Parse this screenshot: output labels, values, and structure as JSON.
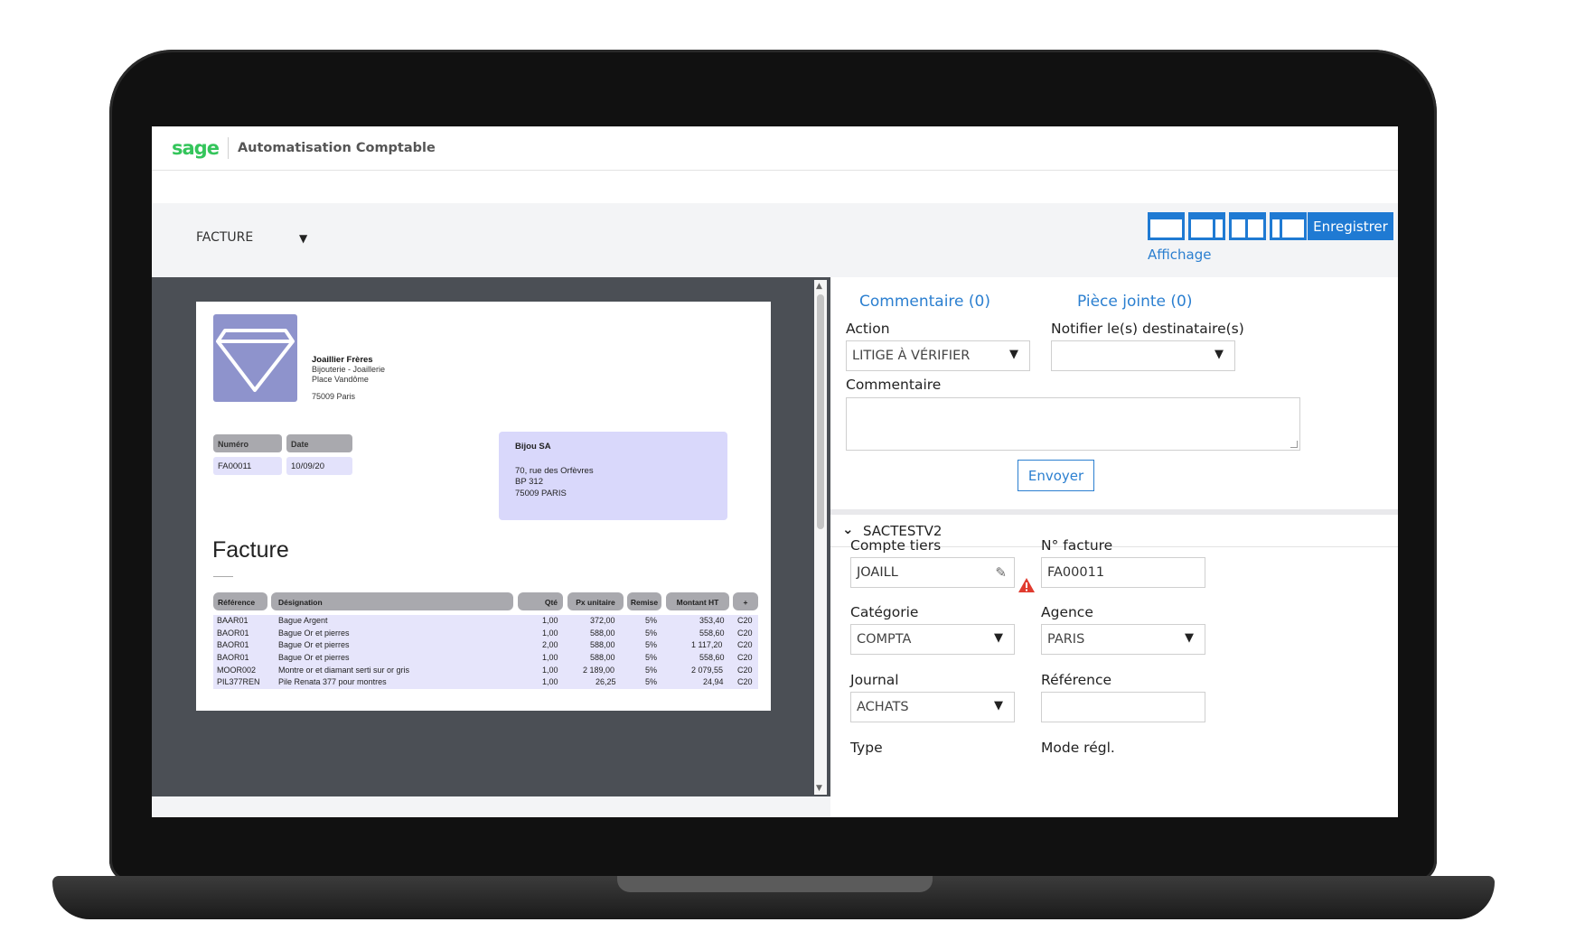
{
  "header": {
    "logo": "sage",
    "app_title": "Automatisation Comptable"
  },
  "toolbar": {
    "doc_type": "FACTURE",
    "save_label": "Enregistrer",
    "affichage_label": "Affichage"
  },
  "invoice": {
    "company_name": "Joaillier Frères",
    "company_line1": "Bijouterie - Joaillerie",
    "company_line2": "Place Vandôme",
    "company_city": "75009 Paris",
    "numero_label": "Numéro",
    "date_label": "Date",
    "numero": "FA00011",
    "date": "10/09/20",
    "client_name": "Bijou SA",
    "client_addr1": "70, rue des Orfèvres",
    "client_addr2": "BP 312",
    "client_addr3": "75009 PARIS",
    "title": "Facture",
    "columns": [
      "Référence",
      "Désignation",
      "Qté",
      "Px unitaire",
      "Remise",
      "Montant HT",
      "+"
    ],
    "rows": [
      [
        "BAAR01",
        "Bague Argent",
        "1,00",
        "372,00",
        "5%",
        "353,40",
        "C20"
      ],
      [
        "BAOR01",
        "Bague Or et pierres",
        "1,00",
        "588,00",
        "5%",
        "558,60",
        "C20"
      ],
      [
        "BAOR01",
        "Bague Or et pierres",
        "2,00",
        "588,00",
        "5%",
        "1 117,20",
        "C20"
      ],
      [
        "BAOR01",
        "Bague Or et pierres",
        "1,00",
        "588,00",
        "5%",
        "558,60",
        "C20"
      ],
      [
        "MOOR002",
        "Montre or et diamant serti sur or gris",
        "1,00",
        "2 189,00",
        "5%",
        "2 079,55",
        "C20"
      ],
      [
        "PIL377REN",
        "Pile Renata 377 pour montres",
        "1,00",
        "26,25",
        "5%",
        "24,94",
        "C20"
      ]
    ]
  },
  "panel": {
    "comment_tab": "Commentaire (0)",
    "attachment_tab": "Pièce jointe (0)",
    "action_label": "Action",
    "action_value": "LITIGE À VÉRIFIER",
    "notify_label": "Notifier le(s) destinataire(s)",
    "notify_value": "",
    "comment_label": "Commentaire",
    "send_label": "Envoyer",
    "section_title": "SACTESTV2",
    "compte_label": "Compte tiers",
    "compte_value": "JOAILL",
    "facture_label": "N° facture",
    "facture_value": "FA00011",
    "categorie_label": "Catégorie",
    "categorie_value": "COMPTA",
    "agence_label": "Agence",
    "agence_value": "PARIS",
    "journal_label": "Journal",
    "journal_value": "ACHATS",
    "reference_label": "Référence",
    "reference_value": "",
    "type_label": "Type",
    "mode_label": "Mode régl."
  },
  "colors": {
    "accent": "#1f7ad3",
    "brand": "#34c55b",
    "warning": "#e03b2f",
    "invoice_logo": "#8e93cc"
  }
}
